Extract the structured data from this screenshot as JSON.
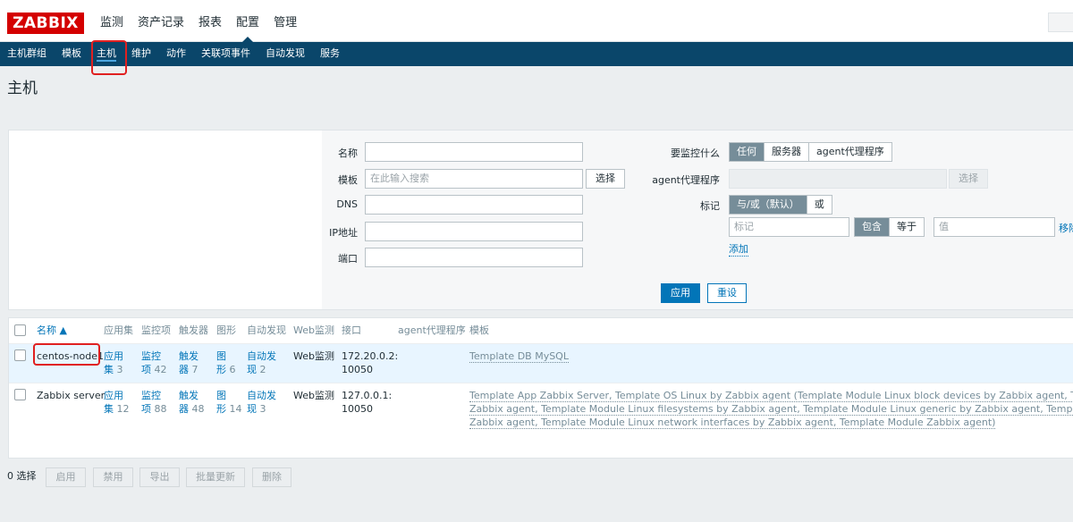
{
  "logo": "ZABBIX",
  "main_menu": [
    "监测",
    "资产记录",
    "报表",
    "配置",
    "管理"
  ],
  "main_menu_active": "配置",
  "sub_nav": [
    "主机群组",
    "模板",
    "主机",
    "维护",
    "动作",
    "关联项事件",
    "自动发现",
    "服务"
  ],
  "sub_nav_active": "主机",
  "page_title": "主机",
  "filter": {
    "name_label": "名称",
    "template_label": "模板",
    "template_placeholder": "在此输入搜索",
    "select_button": "选择",
    "dns_label": "DNS",
    "ip_label": "IP地址",
    "port_label": "端口",
    "monitored_by_label": "要监控什么",
    "monitored_by_options": [
      "任何",
      "服务器",
      "agent代理程序"
    ],
    "proxy_label": "agent代理程序",
    "proxy_select_button": "选择",
    "tags_label": "标记",
    "tags_mode_options": [
      "与/或（默认）",
      "或"
    ],
    "tag_placeholder": "标记",
    "tag_operator_options": [
      "包含",
      "等于"
    ],
    "value_placeholder": "值",
    "remove_link": "移除",
    "add_link": "添加",
    "apply_button": "应用",
    "reset_button": "重设"
  },
  "table": {
    "headers": {
      "name": "名称 ▲",
      "applications": "应用集",
      "items": "监控项",
      "triggers": "触发器",
      "graphs": "图形",
      "discovery": "自动发现",
      "web": "Web监测",
      "interface": "接口",
      "proxy": "agent代理程序",
      "templates": "模板"
    },
    "rows": [
      {
        "name": "centos-node1",
        "app_l1": "应用",
        "app_l2": "集",
        "app_count": "3",
        "item_l1": "监控",
        "item_l2": "项",
        "item_count": "42",
        "trig_l1": "触发",
        "trig_l2": "器",
        "trig_count": "7",
        "graph_l1": "图",
        "graph_l2": "形",
        "graph_count": "6",
        "disc_l1": "自动发",
        "disc_l2": "现",
        "disc_count": "2",
        "web": "Web监测",
        "iface_l1": "172.20.0.2:",
        "iface_l2": "10050",
        "template_line1": "Template DB MySQL"
      },
      {
        "name": "Zabbix server",
        "app_l1": "应用",
        "app_l2": "集",
        "app_count": "12",
        "item_l1": "监控",
        "item_l2": "项",
        "item_count": "88",
        "trig_l1": "触发",
        "trig_l2": "器",
        "trig_count": "48",
        "graph_l1": "图",
        "graph_l2": "形",
        "graph_count": "14",
        "disc_l1": "自动发",
        "disc_l2": "现",
        "disc_count": "3",
        "web": "Web监测",
        "iface_l1": "127.0.0.1:",
        "iface_l2": "10050",
        "template_line1": "Template App Zabbix Server, Template OS Linux by Zabbix agent (Template Module Linux block devices by Zabbix agent, Template Module Linux CPU by Zabbix agent,",
        "template_line2": "Zabbix agent, Template Module Linux filesystems by Zabbix agent, Template Module Linux generic by Zabbix agent, Template Module Linux memory by Zabbix agent,",
        "template_line3": "Zabbix agent, Template Module Linux network interfaces by Zabbix agent, Template Module Zabbix agent)"
      }
    ]
  },
  "footer": {
    "selected": "0 选择",
    "buttons": [
      "启用",
      "禁用",
      "导出",
      "批量更新",
      "删除"
    ]
  },
  "colors": {
    "brand_red": "#d40000",
    "nav_blue": "#0a466a",
    "link_blue": "#0275b8",
    "segment_on": "#768d99",
    "highlight": "#e02020"
  }
}
